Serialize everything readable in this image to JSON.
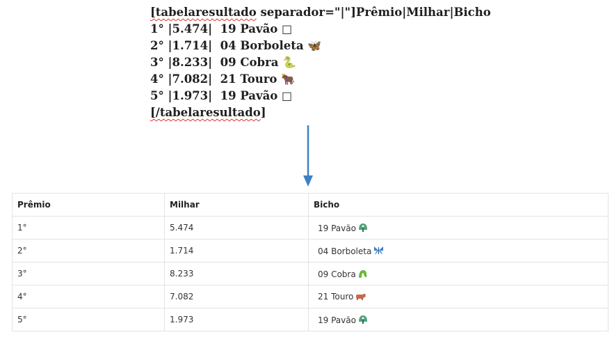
{
  "editor": {
    "open_tag": "[tabelaresultado",
    "open_rest": " separador=\"|\"]Prêmio|Milhar|Bicho",
    "lines": [
      {
        "text": "1° |5.474|  19 Pavão ",
        "emoji": "□"
      },
      {
        "text": "2° |1.714|  04 Borboleta ",
        "emoji": "🦋"
      },
      {
        "text": "3° |8.233|  09 Cobra ",
        "emoji": "🐍"
      },
      {
        "text": "4° |7.082|  21 Touro ",
        "emoji": "🐂"
      },
      {
        "text": "5° |1.973|  19 Pavão ",
        "emoji": "□"
      }
    ],
    "close_tag": "[/tabelaresultado",
    "close_rest": "]"
  },
  "colors": {
    "arrow": "#3d80c4",
    "pavao_icon": "#4fa37a",
    "borboleta_icon": "#3a7fd1",
    "cobra_icon": "#6bb63a",
    "touro_icon": "#c96a47"
  },
  "table": {
    "headers": [
      "Prêmio",
      "Milhar",
      "Bicho"
    ],
    "rows": [
      {
        "premio": "1°",
        "milhar": "5.474",
        "bicho": "19 Pavão",
        "icon": "peacock-icon"
      },
      {
        "premio": "2°",
        "milhar": "1.714",
        "bicho": "04 Borboleta",
        "icon": "butterfly-icon"
      },
      {
        "premio": "3°",
        "milhar": "8.233",
        "bicho": "09 Cobra",
        "icon": "snake-icon"
      },
      {
        "premio": "4°",
        "milhar": "7.082",
        "bicho": "21 Touro",
        "icon": "bull-icon"
      },
      {
        "premio": "5°",
        "milhar": "1.973",
        "bicho": "19 Pavão",
        "icon": "peacock-icon"
      }
    ]
  }
}
